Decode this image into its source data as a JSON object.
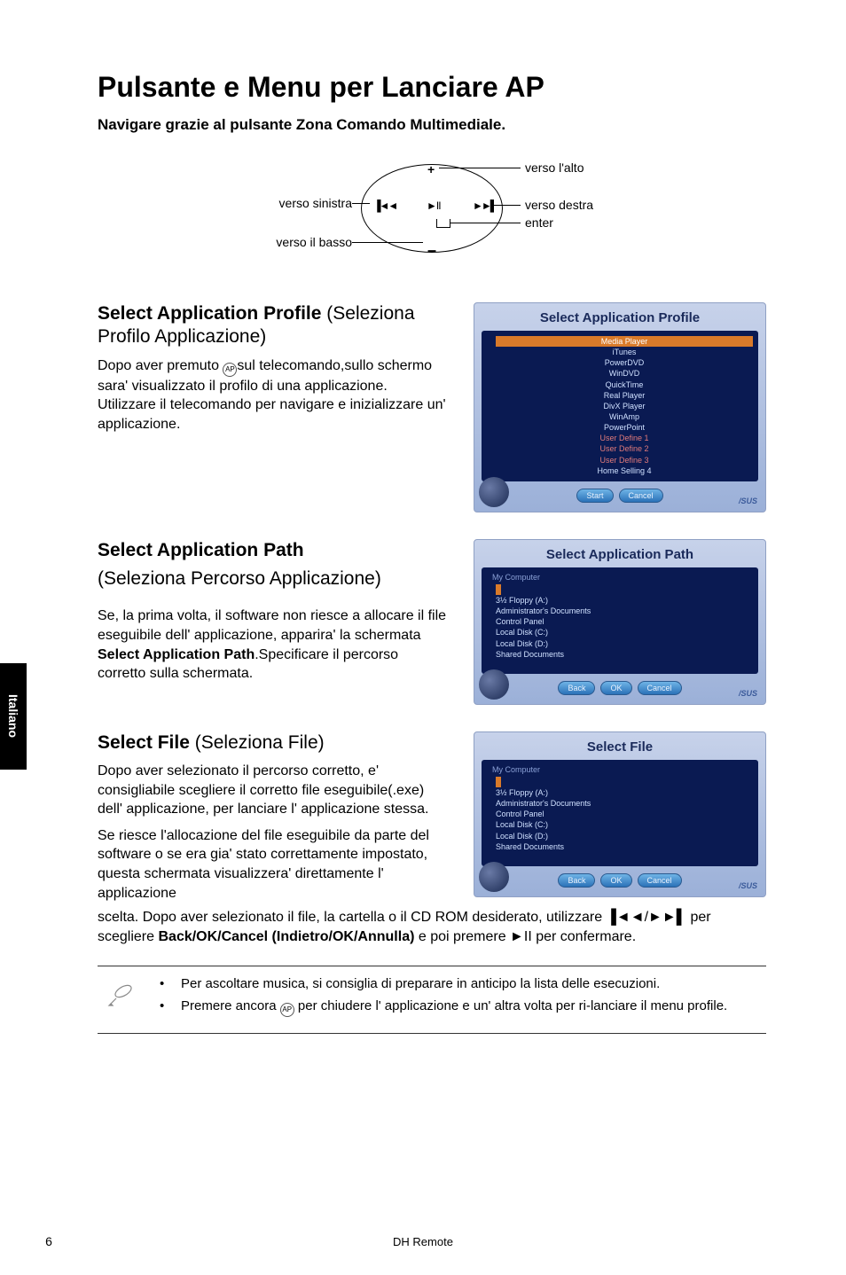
{
  "title": "Pulsante e Menu per Lanciare AP",
  "subhead": "Navigare grazie al pulsante  Zona Comando Multimediale.",
  "diagram": {
    "up": "verso l'alto",
    "right": "verso destra",
    "enter": "enter",
    "left": "verso sinistra",
    "down": "verso il basso",
    "plus": "+",
    "minus": "–",
    "prev": "▐◄◄",
    "play": "►II",
    "next": "►►▌"
  },
  "sections": {
    "profile": {
      "heading_bold": "Select Application Profile ",
      "heading_light": "(Seleziona Profilo Applicazione)",
      "body_pre": "Dopo aver premuto ",
      "body_post": "sul telecomando,sullo schermo sara' visualizzato il profilo di una applicazione. Utilizzare il telecomando per navigare e inizializzare un' applicazione."
    },
    "path": {
      "heading_bold": "Select Application Path",
      "heading_light": "(Seleziona Percorso Applicazione)",
      "body_pre": "Se, la prima volta, il software non riesce a allocare il file eseguibile dell' applicazione, apparira' la schermata ",
      "body_bold": "Select Application Path",
      "body_post": ".Specificare il percorso corretto sulla schermata."
    },
    "file": {
      "heading_bold": "Select File ",
      "heading_light": "(Seleziona File)",
      "body1": "Dopo aver selezionato il percorso corretto, e' consigliabile scegliere il corretto file eseguibile(.exe) dell' applicazione, per lanciare l' applicazione stessa.",
      "body2": "Se riesce l'allocazione del file eseguibile da parte del software o se era gia' stato correttamente impostato, questa schermata visualizzera' direttamente l' applicazione",
      "full_pre": "scelta. Dopo aver selezionato il file, la cartella o il CD ROM desiderato, utilizzare ",
      "sym1": "▐◄◄",
      "slash": "/",
      "sym2": "►►▌",
      "full_mid": " per scegliere ",
      "full_bold": "Back/OK/Cancel (Indietro/OK/Annulla)",
      "full_post1": " e poi premere ",
      "sym3": "►II",
      "full_post2": " per confermare."
    }
  },
  "shots": {
    "profile": {
      "title": "Select Application Profile",
      "items": [
        "Media Player",
        "iTunes",
        "PowerDVD",
        "WinDVD",
        "QuickTime",
        "Real Player",
        "DivX Player",
        "WinAmp",
        "PowerPoint",
        "User Define 1",
        "User Define 2",
        "User Define 3",
        "Home Selling 4"
      ],
      "highlight_index": 0,
      "buttons": [
        "Start",
        "Cancel"
      ]
    },
    "path": {
      "title": "Select Application Path",
      "sub": "My Computer",
      "items": [
        "3½ Floppy (A:)",
        "Administrator's Documents",
        "Control Panel",
        "Local Disk (C:)",
        "Local Disk (D:)",
        "Shared Documents"
      ],
      "buttons": [
        "Back",
        "OK",
        "Cancel"
      ]
    },
    "file": {
      "title": "Select File",
      "sub": "My Computer",
      "items": [
        "3½ Floppy (A:)",
        "Administrator's Documents",
        "Control Panel",
        "Local Disk (C:)",
        "Local Disk (D:)",
        "Shared Documents"
      ],
      "buttons": [
        "Back",
        "OK",
        "Cancel"
      ]
    },
    "logo": "/SUS"
  },
  "notes": {
    "n1": "Per ascoltare musica, si consiglia di preparare in anticipo la lista delle esecuzioni.",
    "n2_pre": "Premere ancora ",
    "n2_post": "  per chiudere l' applicazione e un' altra volta per ri-lanciare il menu profile."
  },
  "sidebar": "Italiano",
  "footer": {
    "page": "6",
    "title": "DH Remote"
  },
  "icons": {
    "ap": "AP"
  }
}
